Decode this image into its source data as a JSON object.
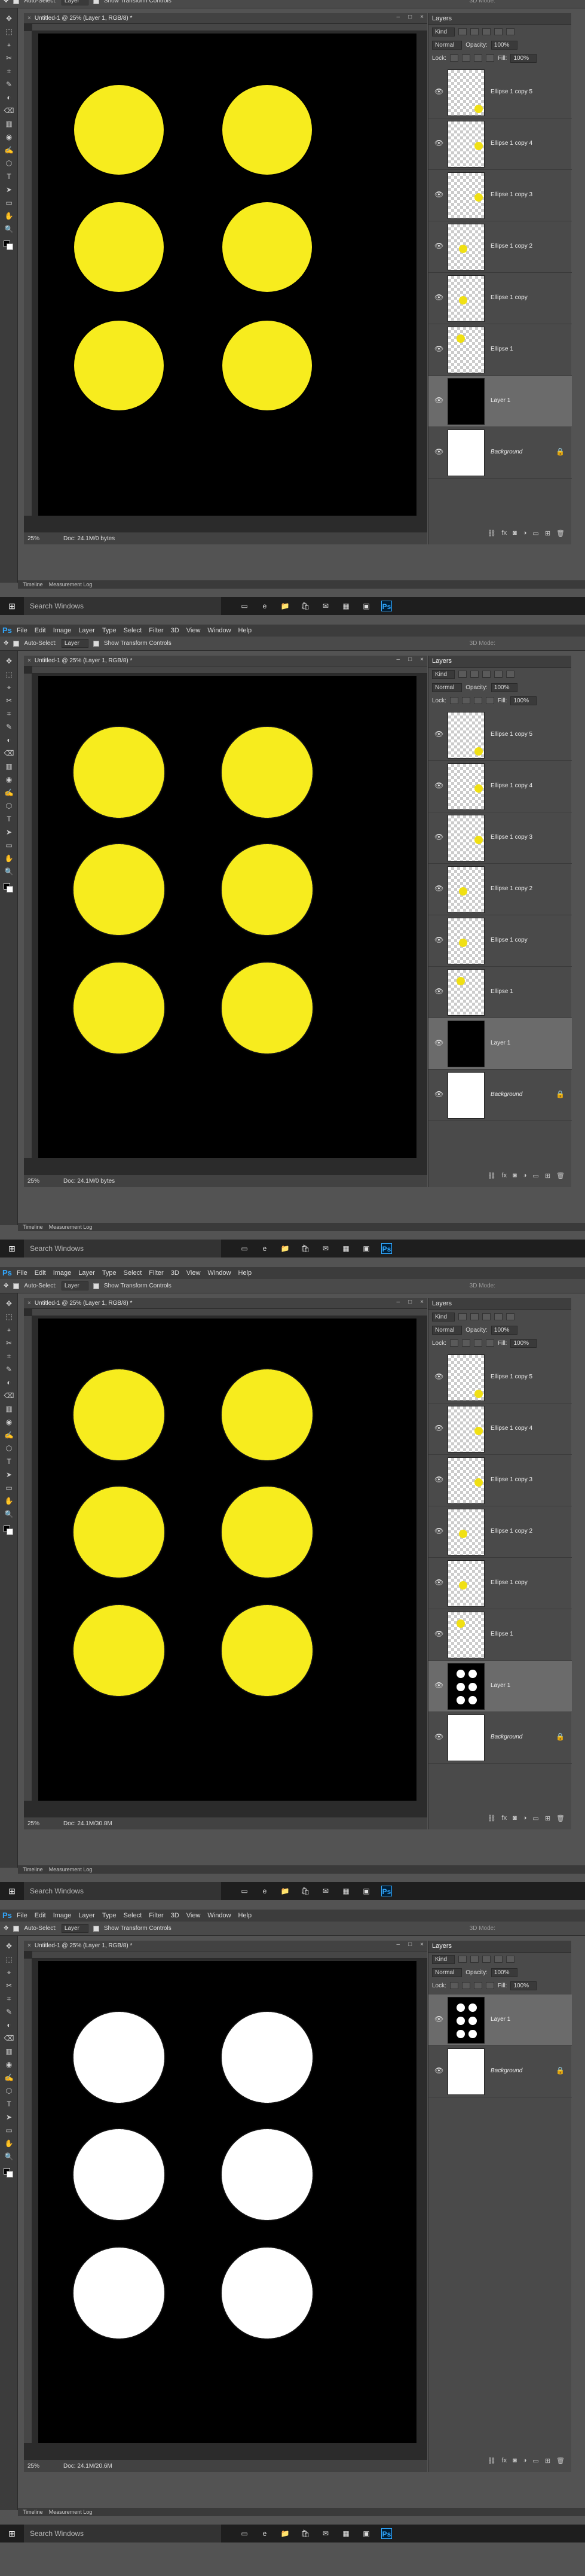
{
  "app": {
    "menu": [
      "File",
      "Edit",
      "Image",
      "Layer",
      "Type",
      "Select",
      "Filter",
      "3D",
      "View",
      "Window",
      "Help"
    ],
    "options": {
      "auto_select_label": "Auto-Select:",
      "auto_select_value": "Layer",
      "transform_label": "Show Transform Controls",
      "mode_3d": "3D Mode:"
    },
    "taskbar": {
      "search_placeholder": "Search Windows",
      "app_icons": [
        "task-view-icon",
        "edge-icon",
        "file-explorer-icon",
        "store-icon",
        "mail-icon",
        "calculator-icon",
        "photos-icon",
        "photoshop-icon"
      ]
    },
    "timeline_tabs": [
      "Timeline",
      "Measurement Log"
    ],
    "colors": {
      "yellow": "#f7ec1e",
      "white": "#ffffff",
      "canvas": "#000000",
      "accent": "#31a8ff"
    }
  },
  "frames": [
    {
      "doc_title": "Untitled-1 @ 25% (Layer 1, RGB/8) *",
      "zoom": "25%",
      "doc_size": "Doc: 24.1M/0 bytes",
      "circle_color": "#f7ec1e",
      "circle_edge": "smooth",
      "panel": {
        "title": "Layers",
        "kind": "Kind",
        "blend": "Normal",
        "opacity_label": "Opacity:",
        "opacity": "100%",
        "lock_label": "Lock:",
        "fill_label": "Fill:",
        "fill": "100%"
      },
      "layers": [
        {
          "name": "Ellipse 1 copy 5",
          "thumb": "checker-dot",
          "dot_pos": "br",
          "active": false
        },
        {
          "name": "Ellipse 1 copy 4",
          "thumb": "checker-dot",
          "dot_pos": "mr",
          "active": false
        },
        {
          "name": "Ellipse 1 copy 3",
          "thumb": "checker-dot",
          "dot_pos": "mr",
          "active": false
        },
        {
          "name": "Ellipse 1 copy 2",
          "thumb": "checker-dot",
          "dot_pos": "ml",
          "active": false
        },
        {
          "name": "Ellipse 1 copy",
          "thumb": "checker-dot",
          "dot_pos": "ml",
          "active": false
        },
        {
          "name": "Ellipse 1",
          "thumb": "checker-dot",
          "dot_pos": "tl",
          "active": false
        },
        {
          "name": "Layer 1",
          "thumb": "black",
          "active": true
        },
        {
          "name": "Background",
          "thumb": "white",
          "italic": true,
          "locked": true,
          "active": false
        }
      ]
    },
    {
      "doc_title": "Untitled-1 @ 25% (Layer 1, RGB/8) *",
      "zoom": "25%",
      "doc_size": "Doc: 24.1M/0 bytes",
      "circle_color": "#f7ec1e",
      "circle_edge": "jagged",
      "panel": {
        "title": "Layers",
        "kind": "Kind",
        "blend": "Normal",
        "opacity_label": "Opacity:",
        "opacity": "100%",
        "lock_label": "Lock:",
        "fill_label": "Fill:",
        "fill": "100%"
      },
      "layers": [
        {
          "name": "Ellipse 1 copy 5",
          "thumb": "checker-dot",
          "dot_pos": "br",
          "active": false
        },
        {
          "name": "Ellipse 1 copy 4",
          "thumb": "checker-dot",
          "dot_pos": "mr",
          "active": false
        },
        {
          "name": "Ellipse 1 copy 3",
          "thumb": "checker-dot",
          "dot_pos": "mr",
          "active": false
        },
        {
          "name": "Ellipse 1 copy 2",
          "thumb": "checker-dot",
          "dot_pos": "ml",
          "active": false
        },
        {
          "name": "Ellipse 1 copy",
          "thumb": "checker-dot",
          "dot_pos": "ml",
          "active": false
        },
        {
          "name": "Ellipse 1",
          "thumb": "checker-dot",
          "dot_pos": "tl",
          "active": false
        },
        {
          "name": "Layer 1",
          "thumb": "black",
          "active": true
        },
        {
          "name": "Background",
          "thumb": "white",
          "italic": true,
          "locked": true,
          "active": false
        }
      ]
    },
    {
      "doc_title": "Untitled-1 @ 25% (Layer 1, RGB/8) *",
      "zoom": "25%",
      "doc_size": "Doc: 24.1M/30.8M",
      "circle_color": "#f7ec1e",
      "circle_edge": "jagged",
      "panel": {
        "title": "Layers",
        "kind": "Kind",
        "blend": "Normal",
        "opacity_label": "Opacity:",
        "opacity": "100%",
        "lock_label": "Lock:",
        "fill_label": "Fill:",
        "fill": "100%"
      },
      "layers": [
        {
          "name": "Ellipse 1 copy 5",
          "thumb": "checker-dot",
          "dot_pos": "br",
          "active": false
        },
        {
          "name": "Ellipse 1 copy 4",
          "thumb": "checker-dot",
          "dot_pos": "mr",
          "active": false
        },
        {
          "name": "Ellipse 1 copy 3",
          "thumb": "checker-dot",
          "dot_pos": "mr",
          "active": false
        },
        {
          "name": "Ellipse 1 copy 2",
          "thumb": "checker-dot",
          "dot_pos": "ml",
          "active": false
        },
        {
          "name": "Ellipse 1 copy",
          "thumb": "checker-dot",
          "dot_pos": "ml",
          "active": false
        },
        {
          "name": "Ellipse 1",
          "thumb": "checker-dot",
          "dot_pos": "tl",
          "active": false
        },
        {
          "name": "Layer 1",
          "thumb": "black-dots",
          "active": true
        },
        {
          "name": "Background",
          "thumb": "white",
          "italic": true,
          "locked": true,
          "active": false
        }
      ]
    },
    {
      "doc_title": "Untitled-1 @ 25% (Layer 1, RGB/8) *",
      "zoom": "25%",
      "doc_size": "Doc: 24.1M/20.6M",
      "circle_color": "#ffffff",
      "circle_edge": "jagged",
      "panel": {
        "title": "Layers",
        "kind": "Kind",
        "blend": "Normal",
        "opacity_label": "Opacity:",
        "opacity": "100%",
        "lock_label": "Lock:",
        "fill_label": "Fill:",
        "fill": "100%"
      },
      "layers": [
        {
          "name": "Layer 1",
          "thumb": "black-dots",
          "active": true
        },
        {
          "name": "Background",
          "thumb": "white",
          "italic": true,
          "locked": true,
          "active": false
        }
      ]
    }
  ]
}
